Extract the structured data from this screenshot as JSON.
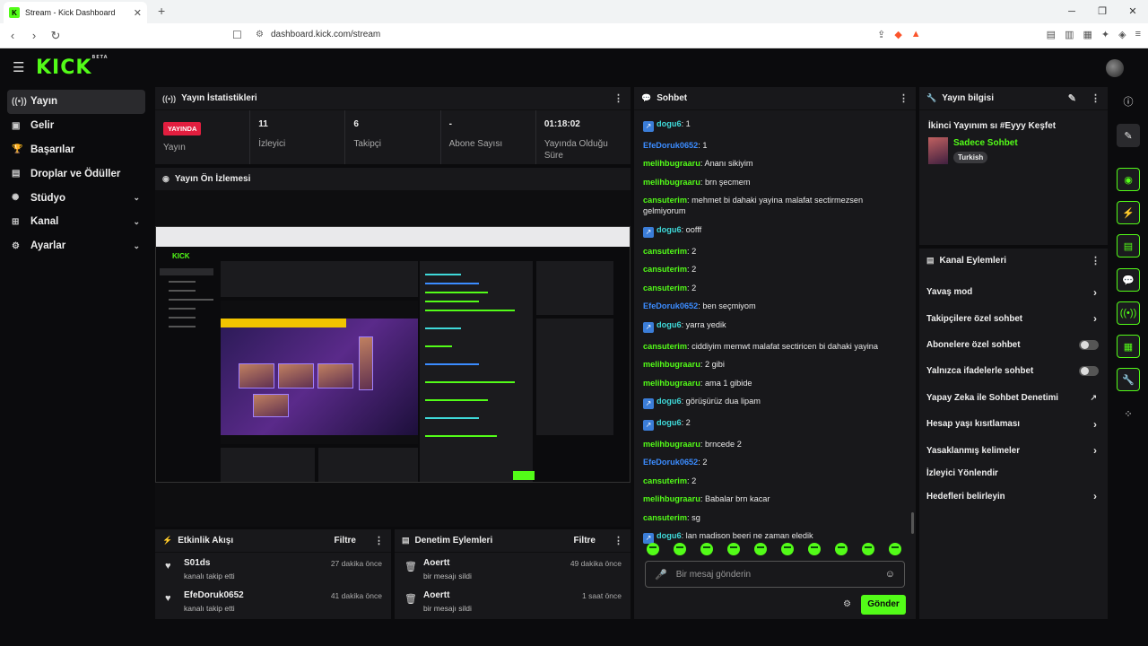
{
  "browser": {
    "tab_title": "Stream - Kick Dashboard",
    "tab_favicon": "K",
    "url": "dashboard.kick.com/stream"
  },
  "app": {
    "logo": "KICK",
    "logo_badge": "BETA"
  },
  "sidebar": {
    "items": [
      {
        "label": "Yayın",
        "icon": "broadcast-icon",
        "active": true
      },
      {
        "label": "Gelir",
        "icon": "wallet-icon"
      },
      {
        "label": "Başarılar",
        "icon": "trophy-icon"
      },
      {
        "label": "Droplar ve Ödüller",
        "icon": "gift-icon"
      },
      {
        "label": "Stüdyo",
        "icon": "studio-icon",
        "expandable": true
      },
      {
        "label": "Kanal",
        "icon": "channel-icon",
        "expandable": true
      },
      {
        "label": "Ayarlar",
        "icon": "gear-icon",
        "expandable": true
      }
    ]
  },
  "stats_panel": {
    "title": "Yayın İstatistikleri",
    "live_badge": "YAYINDA",
    "items": [
      {
        "value": "",
        "label": "Yayın"
      },
      {
        "value": "11",
        "label": "İzleyici"
      },
      {
        "value": "6",
        "label": "Takipçi"
      },
      {
        "value": "-",
        "label": "Abone Sayısı"
      },
      {
        "value": "01:18:02",
        "label": "Yayında Olduğu Süre"
      }
    ]
  },
  "preview_panel": {
    "title": "Yayın Ön İzlemesi"
  },
  "activity_panel": {
    "title": "Etkinlik Akışı",
    "filter": "Filtre",
    "items": [
      {
        "name": "S01ds",
        "sub": "kanalı takip etti",
        "time": "27 dakika önce"
      },
      {
        "name": "EfeDoruk0652",
        "sub": "kanalı takip etti",
        "time": "41 dakika önce"
      }
    ]
  },
  "moderation_panel": {
    "title": "Denetim Eylemleri",
    "filter": "Filtre",
    "items": [
      {
        "name": "Aoertt",
        "sub": "bir mesajı sildi",
        "time": "49 dakika önce"
      },
      {
        "name": "Aoertt",
        "sub": "bir mesajı sildi",
        "time": "1 saat önce"
      }
    ]
  },
  "chat": {
    "title": "Sohbet",
    "messages": [
      {
        "user": "dogu6",
        "color": "c",
        "badge": true,
        "text": "1"
      },
      {
        "user": "EfeDoruk0652",
        "color": "b",
        "badge": false,
        "text": "1"
      },
      {
        "user": "melihbugraaru",
        "color": "g",
        "badge": false,
        "text": "Ananı sikiyim"
      },
      {
        "user": "melihbugraaru",
        "color": "g",
        "badge": false,
        "text": "brn şecmem"
      },
      {
        "user": "cansuterim",
        "color": "g",
        "badge": false,
        "text": "mehmet bi dahaki yayina malafat sectirmezsen gelmiyorum"
      },
      {
        "user": "dogu6",
        "color": "c",
        "badge": true,
        "text": "oofff"
      },
      {
        "user": "cansuterim",
        "color": "g",
        "badge": false,
        "text": "2"
      },
      {
        "user": "cansuterim",
        "color": "g",
        "badge": false,
        "text": "2"
      },
      {
        "user": "cansuterim",
        "color": "g",
        "badge": false,
        "text": "2"
      },
      {
        "user": "EfeDoruk0652",
        "color": "b",
        "badge": false,
        "text": "ben seçmiyom"
      },
      {
        "user": "dogu6",
        "color": "c",
        "badge": true,
        "text": "yarra yedik"
      },
      {
        "user": "cansuterim",
        "color": "g",
        "badge": false,
        "text": "ciddiyim memwt malafat sectiricen bi dahaki yayina"
      },
      {
        "user": "melihbugraaru",
        "color": "g",
        "badge": false,
        "text": "2 gibi"
      },
      {
        "user": "melihbugraaru",
        "color": "g",
        "badge": false,
        "text": "ama 1 gibide"
      },
      {
        "user": "dogu6",
        "color": "c",
        "badge": true,
        "text": "görüşürüz dua lipam"
      },
      {
        "user": "dogu6",
        "color": "c",
        "badge": true,
        "text": "2"
      },
      {
        "user": "melihbugraaru",
        "color": "g",
        "badge": false,
        "text": "brncede 2"
      },
      {
        "user": "EfeDoruk0652",
        "color": "b",
        "badge": false,
        "text": "2"
      },
      {
        "user": "cansuterim",
        "color": "g",
        "badge": false,
        "text": "2"
      },
      {
        "user": "melihbugraaru",
        "color": "g",
        "badge": false,
        "text": "Babalar brn kacar"
      },
      {
        "user": "cansuterim",
        "color": "g",
        "badge": false,
        "text": "sg"
      },
      {
        "user": "dogu6",
        "color": "c",
        "badge": true,
        "text": "lan madison beeri ne zaman eledik"
      }
    ],
    "input_placeholder": "Bir mesaj gönderin",
    "send_label": "Gönder"
  },
  "stream_info": {
    "title": "Yayın bilgisi",
    "stream_title": "İkinci Yayınım sı #Eyyy Keşfet",
    "category": "Sadece Sohbet",
    "tag": "Turkish"
  },
  "channel_actions": {
    "title": "Kanal Eylemleri",
    "items": [
      {
        "label": "Yavaş mod",
        "control": "chevron"
      },
      {
        "label": "Takipçilere özel sohbet",
        "control": "chevron"
      },
      {
        "label": "Abonelere özel sohbet",
        "control": "toggle"
      },
      {
        "label": "Yalnızca ifadelerle sohbet",
        "control": "toggle"
      },
      {
        "label": "Yapay Zeka ile Sohbet Denetimi",
        "control": "external"
      },
      {
        "label": "Hesap yaşı kısıtlaması",
        "control": "chevron"
      },
      {
        "label": "Yasaklanmış kelimeler",
        "control": "chevron"
      },
      {
        "label": "İzleyici Yönlendir",
        "control": "none"
      },
      {
        "label": "Hedefleri belirleyin",
        "control": "chevron"
      }
    ]
  },
  "colors": {
    "accent": "#53fc18",
    "live": "#e21e3f",
    "background": "#0b0b0d",
    "panel": "#18181b"
  }
}
